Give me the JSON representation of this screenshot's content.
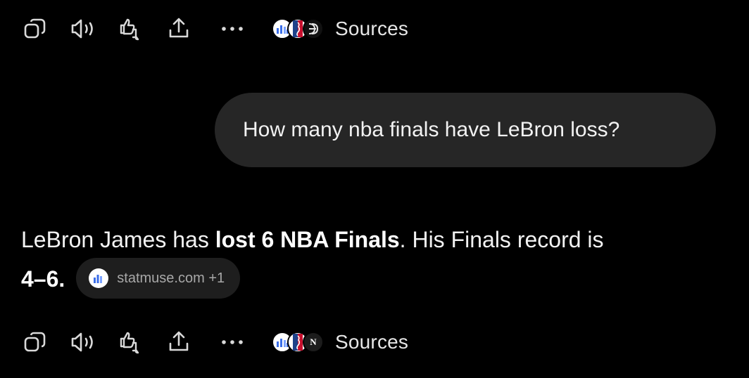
{
  "top_actions": {
    "copy_icon": "copy-icon",
    "speaker_icon": "speaker-icon",
    "feedback_icon": "thumbs-feedback-icon",
    "share_icon": "share-icon",
    "more_icon": "more-icon",
    "sources_label": "Sources"
  },
  "user_message": {
    "text": "How many nba finals have LeBron loss?"
  },
  "answer": {
    "part1": "LeBron James has ",
    "bold": "lost 6 NBA Finals",
    "part2": ". His Finals record is ",
    "record": "4–6",
    "period": ".",
    "citation": "statmuse.com +1"
  },
  "bottom_actions": {
    "sources_label": "Sources",
    "third_source_letter": "N"
  },
  "colors": {
    "background": "#000000",
    "bubble": "#262626",
    "chip": "#1e1e1e",
    "statmuse_blue": "#3b6ee8"
  }
}
